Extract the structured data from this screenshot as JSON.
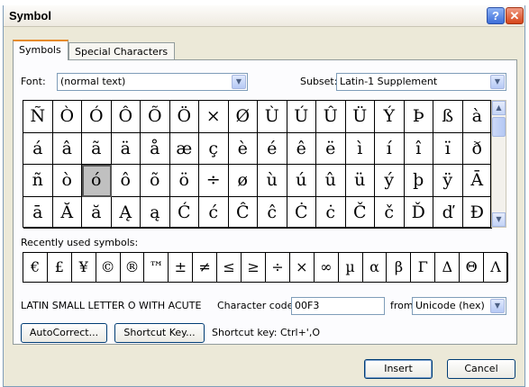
{
  "window": {
    "title": "Symbol",
    "help_label": "?",
    "close_label": "✕"
  },
  "tabs": [
    {
      "label": "Symbols",
      "active": true
    },
    {
      "label": "Special Characters",
      "active": false
    }
  ],
  "font": {
    "label": "Font:",
    "value": "(normal text)"
  },
  "subset": {
    "label": "Subset:",
    "value": "Latin-1 Supplement"
  },
  "symbols": [
    "Ñ",
    "Ò",
    "Ó",
    "Ô",
    "Õ",
    "Ö",
    "×",
    "Ø",
    "Ù",
    "Ú",
    "Û",
    "Ü",
    "Ý",
    "Þ",
    "ß",
    "à",
    "á",
    "â",
    "ã",
    "ä",
    "å",
    "æ",
    "ç",
    "è",
    "é",
    "ê",
    "ë",
    "ì",
    "í",
    "î",
    "ï",
    "ð",
    "ñ",
    "ò",
    "ó",
    "ô",
    "õ",
    "ö",
    "÷",
    "ø",
    "ù",
    "ú",
    "û",
    "ü",
    "ý",
    "þ",
    "ÿ",
    "Ā",
    "ā",
    "Ă",
    "ă",
    "Ą",
    "ą",
    "Ć",
    "ć",
    "Ĉ",
    "ĉ",
    "Ċ",
    "ċ",
    "Č",
    "č",
    "Ď",
    "ď",
    "Đ"
  ],
  "selected_index": 34,
  "recent": {
    "label": "Recently used symbols:",
    "items": [
      "€",
      "£",
      "¥",
      "©",
      "®",
      "™",
      "±",
      "≠",
      "≤",
      "≥",
      "÷",
      "×",
      "∞",
      "µ",
      "α",
      "β",
      "Γ",
      "Δ",
      "Θ",
      "Λ"
    ]
  },
  "character_name": "LATIN SMALL LETTER O WITH ACUTE",
  "character_code": {
    "label": "Character code:",
    "value": "00F3"
  },
  "from": {
    "label": "from:",
    "value": "Unicode (hex)"
  },
  "buttons": {
    "autocorrect": "AutoCorrect...",
    "shortcut_key": "Shortcut Key...",
    "insert": "Insert",
    "cancel": "Cancel"
  },
  "shortcut_text": "Shortcut key: Ctrl+',O",
  "icons": {
    "dropdown": "chevron-down-icon",
    "scroll_up": "chevron-up-icon",
    "scroll_down": "chevron-down-icon"
  },
  "colors": {
    "accent": "#e68b2c",
    "close": "#d64519",
    "help": "#3d6ed9"
  }
}
